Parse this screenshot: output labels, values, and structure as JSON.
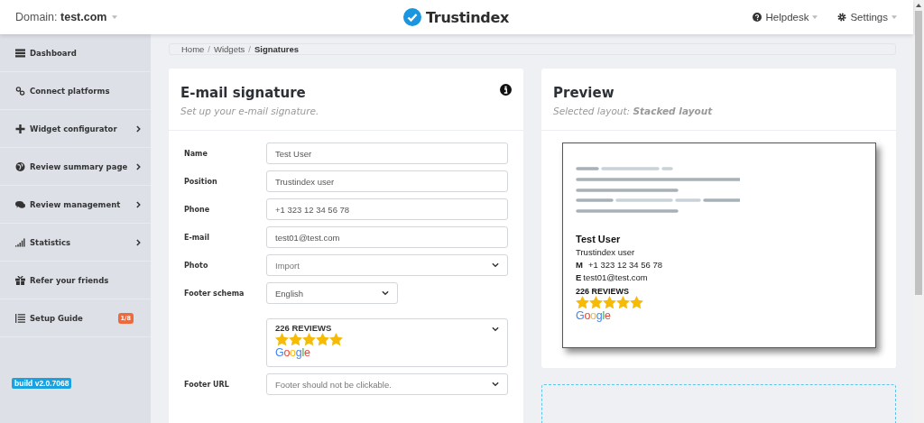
{
  "header": {
    "domain_label": "Domain:",
    "domain": "test.com",
    "logo": "Trustindex",
    "links": [
      {
        "kind": "help",
        "label": "Helpdesk"
      },
      {
        "kind": "settings",
        "label": "Settings"
      }
    ]
  },
  "sidebar": {
    "items": [
      {
        "kind": "dashboard",
        "label": "Dashboard",
        "expandable": false
      },
      {
        "kind": "connect",
        "label": "Connect platforms",
        "expandable": false
      },
      {
        "kind": "plus",
        "label": "Widget configurator",
        "expandable": true
      },
      {
        "kind": "globe",
        "label": "Review summary page",
        "expandable": true
      },
      {
        "kind": "chat",
        "label": "Review management",
        "expandable": true
      },
      {
        "kind": "stats",
        "label": "Statistics",
        "expandable": true
      },
      {
        "kind": "gift",
        "label": "Refer your friends",
        "expandable": false
      },
      {
        "kind": "list",
        "label": "Setup Guide",
        "expandable": false,
        "badge": "1/8"
      }
    ],
    "build": "build v2.0.7068"
  },
  "breadcrumb": [
    {
      "label": "Home",
      "current": false,
      "separator": "/"
    },
    {
      "label": "Widgets",
      "current": false,
      "separator": "/"
    },
    {
      "label": "Signatures",
      "current": true
    }
  ],
  "form_card": {
    "title": "E-mail signature",
    "subtitle": "Set up your e-mail signature.",
    "fields": [
      {
        "kind": "input",
        "label": "Name",
        "value": "Test User"
      },
      {
        "kind": "input",
        "label": "Position",
        "value": "Trustindex user"
      },
      {
        "kind": "input",
        "label": "Phone",
        "value": "+1 323 12 34 56 78"
      },
      {
        "kind": "input",
        "label": "E-mail",
        "value": "test01@test.com"
      },
      {
        "kind": "select",
        "label": "Photo",
        "value": "Import"
      },
      {
        "kind": "short-select",
        "label": "Footer schema",
        "value": "English"
      },
      {
        "kind": "review-select",
        "reviews": "226 REVIEWS",
        "stars": 5,
        "logo": "Google"
      },
      {
        "kind": "select",
        "label": "Footer URL",
        "value": "Footer should not be clickable."
      }
    ]
  },
  "preview_card": {
    "title": "Preview",
    "subtitle": "Selected layout: **Stacked layout**",
    "signature": {
      "name": "Test User",
      "position": "Trustindex user",
      "phone_label": "M",
      "phone": "+1 323 12 34 56 78",
      "email_label": "E",
      "email": "test01@test.com",
      "reviews": "226 REVIEWS",
      "stars": 5,
      "logo": "Google"
    }
  }
}
